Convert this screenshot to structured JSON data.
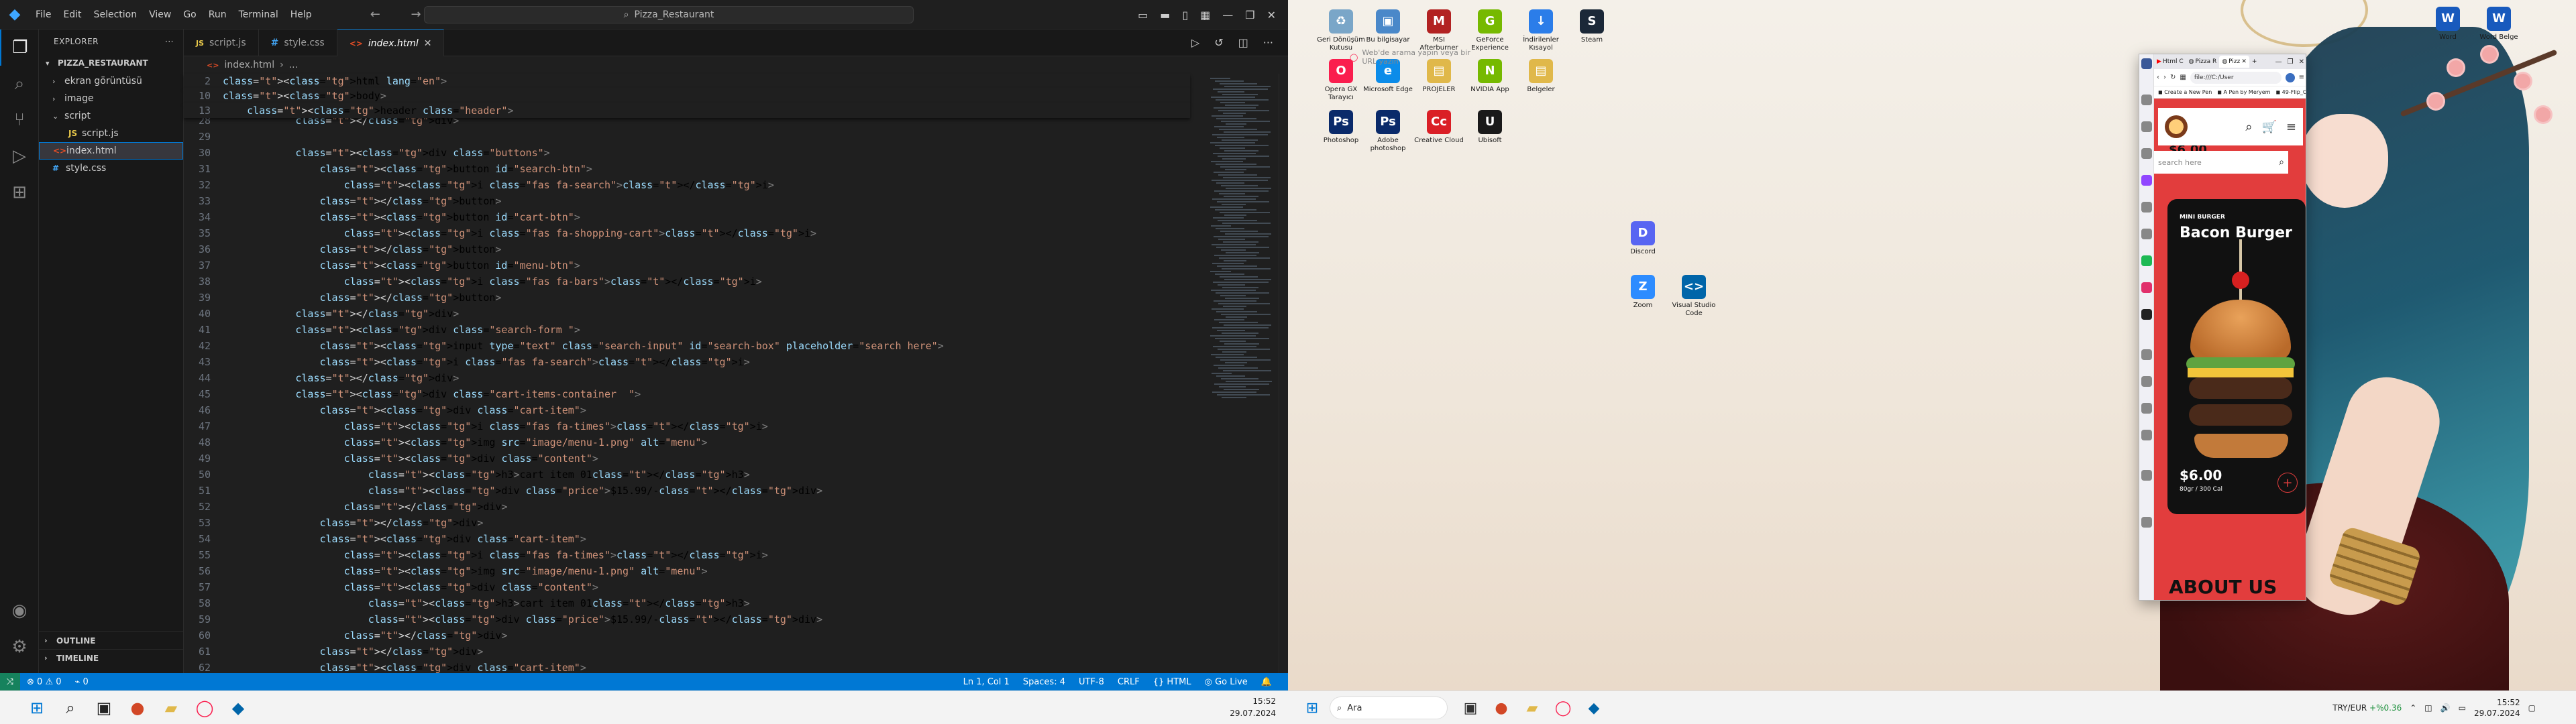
{
  "vscode": {
    "menu": [
      "File",
      "Edit",
      "Selection",
      "View",
      "Go",
      "Run",
      "Terminal",
      "Help"
    ],
    "command_center": "Pizza_Restaurant",
    "explorer": {
      "title": "EXPLORER",
      "folder": "PIZZA_RESTAURANT",
      "items": [
        {
          "label": "ekran görüntüsü",
          "type": "folder"
        },
        {
          "label": "image",
          "type": "folder"
        },
        {
          "label": "script",
          "type": "folder-open"
        },
        {
          "label": "script.js",
          "type": "js"
        },
        {
          "label": "index.html",
          "type": "html"
        },
        {
          "label": "style.css",
          "type": "css"
        }
      ],
      "outline": "OUTLINE",
      "timeline": "TIMELINE"
    },
    "tabs": [
      {
        "label": "script.js",
        "icon": "JS"
      },
      {
        "label": "style.css",
        "icon": "#"
      },
      {
        "label": "index.html",
        "icon": "<>"
      }
    ],
    "breadcrumb": [
      "index.html",
      "..."
    ],
    "sticky_lines": [
      {
        "n": "2",
        "code": "<html lang=\"en\">"
      },
      {
        "n": "10",
        "code": "<body>"
      },
      {
        "n": "13",
        "code": "    <header class=\"header\">"
      }
    ],
    "code_lines": [
      {
        "n": "28",
        "code": "            </div>"
      },
      {
        "n": "29",
        "code": ""
      },
      {
        "n": "30",
        "code": "            <div class=\"buttons\">"
      },
      {
        "n": "31",
        "code": "                <button id=\"search-btn\">"
      },
      {
        "n": "32",
        "code": "                    <i class=\"fas fa-search\"></i>"
      },
      {
        "n": "33",
        "code": "                </button>"
      },
      {
        "n": "34",
        "code": "                <button id=\"cart-btn\">"
      },
      {
        "n": "35",
        "code": "                    <i class=\"fas fa-shopping-cart\"></i>"
      },
      {
        "n": "36",
        "code": "                </button>"
      },
      {
        "n": "37",
        "code": "                <button id=\"menu-btn\">"
      },
      {
        "n": "38",
        "code": "                    <i class=\"fas fa-bars\"></i>"
      },
      {
        "n": "39",
        "code": "                </button>"
      },
      {
        "n": "40",
        "code": "            </div>"
      },
      {
        "n": "41",
        "code": "            <div class=\"search-form \">"
      },
      {
        "n": "42",
        "code": "                <input type=\"text\" class=\"search-input\" id=\"search-box\" placeholder=\"search here\">"
      },
      {
        "n": "43",
        "code": "                <i class=\"fas fa-search\"></i>"
      },
      {
        "n": "44",
        "code": "            </div>"
      },
      {
        "n": "45",
        "code": "            <div class=\"cart-items-container  \">"
      },
      {
        "n": "46",
        "code": "                <div class=\"cart-item\">"
      },
      {
        "n": "47",
        "code": "                    <i class=\"fas fa-times\"></i>"
      },
      {
        "n": "48",
        "code": "                    <img src=\"image/menu-1.png\" alt=\"menu\">"
      },
      {
        "n": "49",
        "code": "                    <div class=\"content\">"
      },
      {
        "n": "50",
        "code": "                        <h3>cart item 01</h3>"
      },
      {
        "n": "51",
        "code": "                        <div class=\"price\">$15.99/-</div>"
      },
      {
        "n": "52",
        "code": "                    </div>"
      },
      {
        "n": "53",
        "code": "                </div>"
      },
      {
        "n": "54",
        "code": "                <div class=\"cart-item\">"
      },
      {
        "n": "55",
        "code": "                    <i class=\"fas fa-times\"></i>"
      },
      {
        "n": "56",
        "code": "                    <img src=\"image/menu-1.png\" alt=\"menu\">"
      },
      {
        "n": "57",
        "code": "                    <div class=\"content\">"
      },
      {
        "n": "58",
        "code": "                        <h3>cart item 01</h3>"
      },
      {
        "n": "59",
        "code": "                        <div class=\"price\">$15.99/-</div>"
      },
      {
        "n": "60",
        "code": "                    </div>"
      },
      {
        "n": "61",
        "code": "                </div>"
      },
      {
        "n": "62",
        "code": "                <div class=\"cart-item\">"
      }
    ],
    "status": {
      "errors": "0",
      "warnings": "0",
      "ports": "0",
      "position": "Ln 1, Col 1",
      "spaces": "Spaces: 4",
      "encoding": "UTF-8",
      "eol": "CRLF",
      "language": "HTML",
      "golive": "Go Live"
    },
    "clock": {
      "time": "15:52",
      "date": "29.07.2024"
    }
  },
  "desktop": {
    "icons": [
      {
        "label": "Geri Dönüşüm Kutusu",
        "color": "#7aa6c8",
        "glyph": "♻"
      },
      {
        "label": "Bu bilgisayar",
        "color": "#4a88c9",
        "glyph": "▣"
      },
      {
        "label": "MSI Afterburner",
        "color": "#b22222",
        "glyph": "M"
      },
      {
        "label": "GeForce Experience",
        "color": "#76b900",
        "glyph": "G"
      },
      {
        "label": "İndirilenler Kısayol",
        "color": "#2b7de9",
        "glyph": "↓"
      },
      {
        "label": "Steam",
        "color": "#1b2838",
        "glyph": "S"
      },
      {
        "label": "Opera GX Tarayıcı",
        "color": "#fa1e4e",
        "glyph": "O"
      },
      {
        "label": "Microsoft Edge",
        "color": "#0c8ce9",
        "glyph": "e"
      },
      {
        "label": "PROJELER",
        "color": "#e0b84a",
        "glyph": "▤"
      },
      {
        "label": "NVIDIA App",
        "color": "#76b900",
        "glyph": "N"
      },
      {
        "label": "Belgeler",
        "color": "#e0b84a",
        "glyph": "▤"
      },
      {
        "label": "Photoshop",
        "color": "#0a2a6a",
        "glyph": "Ps"
      },
      {
        "label": "Adobe photoshop",
        "color": "#0a2a6a",
        "glyph": "Ps"
      },
      {
        "label": "Creative Cloud",
        "color": "#da1f26",
        "glyph": "Cc"
      },
      {
        "label": "Ubisoft",
        "color": "#1a1a1a",
        "glyph": "U"
      },
      {
        "label": "Discord",
        "color": "#5865f2",
        "glyph": "D"
      },
      {
        "label": "Zoom",
        "color": "#2d8cff",
        "glyph": "Z"
      },
      {
        "label": "Visual Studio Code",
        "color": "#0065a9",
        "glyph": "<>"
      },
      {
        "label": "Word",
        "color": "#185abd",
        "glyph": "W"
      },
      {
        "label": "Word Belge",
        "color": "#185abd",
        "glyph": "W"
      }
    ],
    "opera_hint": "Web'de arama yapın veya bir URL yazın",
    "browser": {
      "tabs": [
        "Html C",
        "Pizza R",
        "Pizz"
      ],
      "url": "file:///C:/User",
      "bookmarks": [
        "Create a New Pen",
        "A Pen by Meryem",
        "49-Flip_Card"
      ],
      "site": {
        "search_placeholder": "search here",
        "price_peek": "$6.00",
        "card_sub": "MINI BURGER",
        "card_title": "Bacon Burger",
        "card_price": "$6.00",
        "card_meta": "80gr / 300 Cal",
        "about": "ABOUT US"
      }
    },
    "taskbar": {
      "search": "Ara",
      "currency": "TRY/EUR",
      "currency_change": "+%0.36",
      "time": "15:52",
      "date": "29.07.2024"
    }
  }
}
